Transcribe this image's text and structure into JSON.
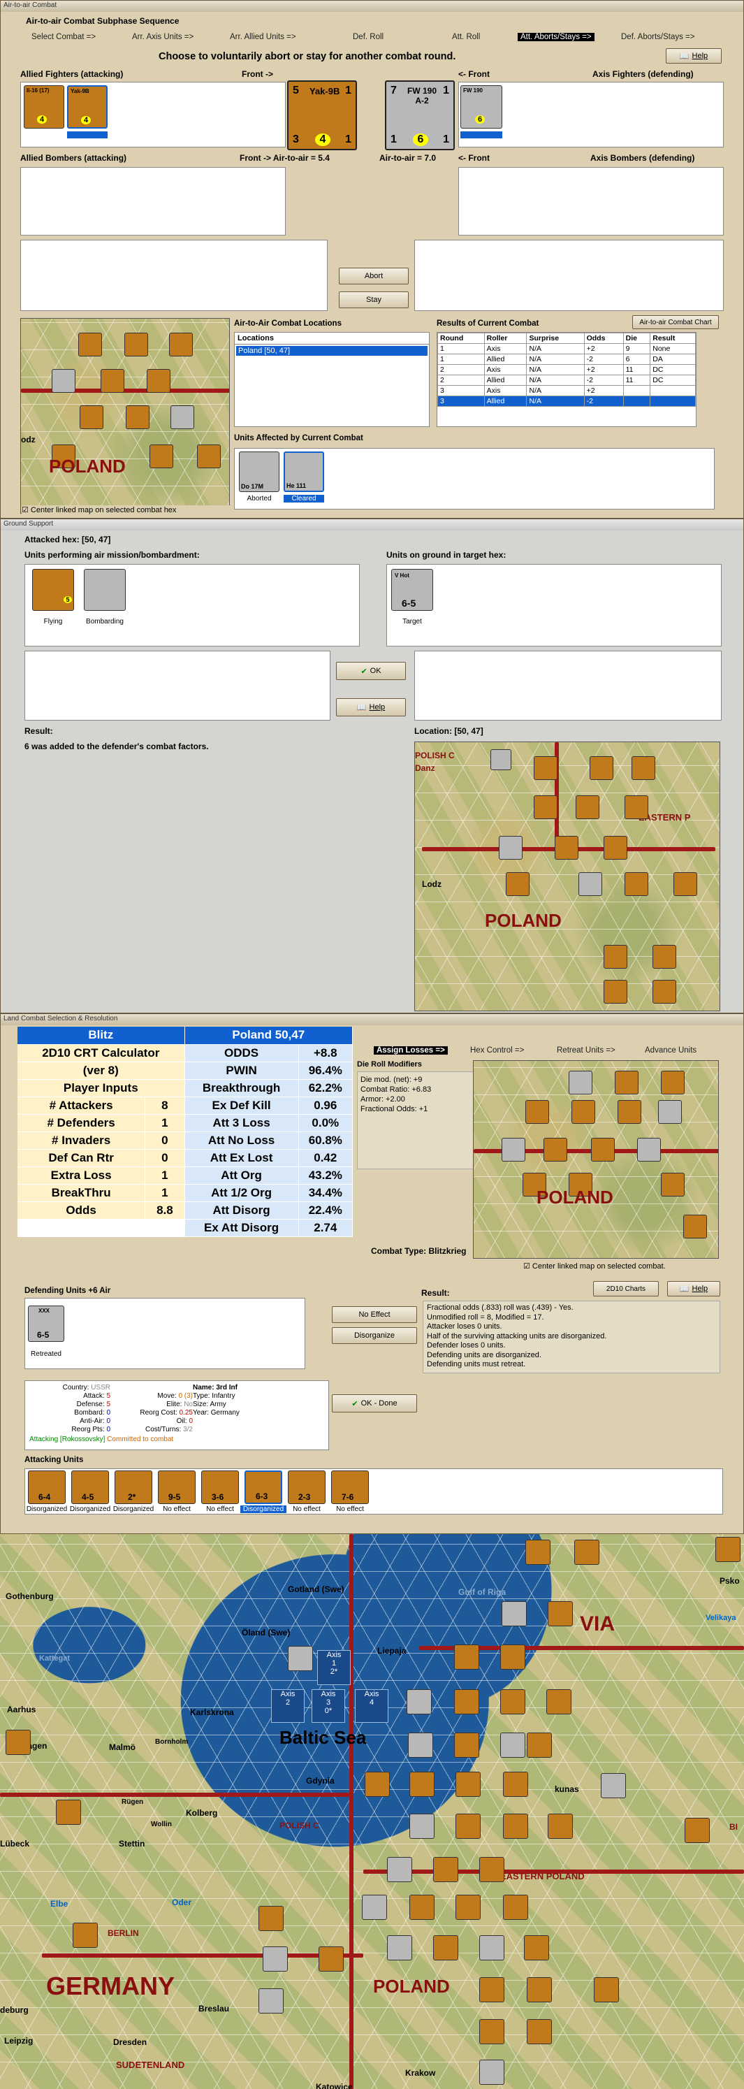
{
  "aircombat": {
    "title": "Air-to-air Combat",
    "heading": "Air-to-air Combat Subphase Sequence",
    "tabs": [
      "Select Combat =>",
      "Arr. Axis Units =>",
      "Arr. Allied Units =>",
      "Def. Roll",
      "Att. Roll",
      "Att. Aborts/Stays =>",
      "Def. Aborts/Stays =>"
    ],
    "active_tab": "Att. Aborts/Stays =>",
    "help_label": "Help",
    "instruction": "Choose to voluntarily abort or stay for another combat round.",
    "allied_fighters_label": "Allied Fighters (attacking)",
    "front_right_label": "Front ->",
    "front_left_label": "<- Front",
    "axis_fighters_label": "Axis Fighters (defending)",
    "allied_bombers_label": "Allied Bombers (attacking)",
    "air_to_air_att": "Front -> Air-to-air = 5.4",
    "air_to_air_def": "Air-to-air = 7.0",
    "axis_bombers_label": "Axis Bombers (defending)",
    "abort_label": "Abort",
    "stay_label": "Stay",
    "locations_section": "Air-to-Air Combat Locations",
    "locations_header": "Locations",
    "locations": [
      "Poland [50, 47]"
    ],
    "results_section": "Results of Current Combat",
    "chart_button": "Air-to-air Combat Chart",
    "results_headers": [
      "Round",
      "Roller",
      "Surprise",
      "Odds",
      "Die",
      "Result"
    ],
    "results_rows": [
      [
        "1",
        "Axis",
        "N/A",
        "+2",
        "9",
        "None"
      ],
      [
        "1",
        "Allied",
        "N/A",
        "-2",
        "6",
        "DA"
      ],
      [
        "2",
        "Axis",
        "N/A",
        "+2",
        "11",
        "DC"
      ],
      [
        "2",
        "Allied",
        "N/A",
        "-2",
        "11",
        "DC"
      ],
      [
        "3",
        "Axis",
        "N/A",
        "+2",
        "",
        ""
      ],
      [
        "3",
        "Allied",
        "N/A",
        "-2",
        "",
        ""
      ]
    ],
    "units_affected_label": "Units Affected by Current Combat",
    "affected": [
      {
        "name": "Do 17M",
        "status": "Aborted"
      },
      {
        "name": "He 111",
        "status": "Cleared"
      }
    ],
    "center_map_label": "Center linked map on selected combat hex",
    "map_poland": "POLAND",
    "map_lodz": "odz",
    "front_unit_left": {
      "top": "Yak-9B",
      "tl": "5",
      "tr": "1",
      "bl": "3",
      "bc": "4",
      "br": "1"
    },
    "front_unit_right": {
      "top": "FW 190 A-2",
      "tl": "7",
      "tr": "1",
      "bl": "1",
      "bc": "6",
      "br": "1"
    },
    "small_units": [
      "Il-16 (17)",
      "Yak-9B",
      "FW 190"
    ]
  },
  "ground": {
    "title": "Ground Support",
    "attacked_hex": "Attacked hex: [50, 47]",
    "performing_label": "Units performing air mission/bombardment:",
    "on_ground_label": "Units on ground in target hex:",
    "flying_caption": "Flying",
    "bombarding_caption": "Bombarding",
    "target_caption": "Target",
    "target_unit": {
      "top": "V Hot",
      "val": "6-5"
    },
    "ok_label": "OK",
    "help_label": "Help",
    "result_label": "Result:",
    "result_text": "6 was added to the defender's combat factors.",
    "location_label": "Location:",
    "location_value": "[50, 47]",
    "map_labels": [
      "POLAND",
      "EASTERN P",
      "Lodz",
      "POLISH C",
      "Danz"
    ]
  },
  "land": {
    "title": "Land Combat Selection & Resolution",
    "crt_header_left": "Blitz",
    "crt_header_right": "Poland 50,47",
    "crt_rows": [
      [
        "2D10 CRT Calculator",
        "",
        "ODDS",
        "+8.8"
      ],
      [
        "(ver 8)",
        "",
        "PWIN",
        "96.4%"
      ],
      [
        "Player Inputs",
        "",
        "Breakthrough",
        "62.2%"
      ],
      [
        "# Attackers",
        "8",
        "Ex Def Kill",
        "0.96"
      ],
      [
        "# Defenders",
        "1",
        "Att 3 Loss",
        "0.0%"
      ],
      [
        "# Invaders",
        "0",
        "Att No Loss",
        "60.8%"
      ],
      [
        "Def Can Rtr",
        "0",
        "Att Ex Lost",
        "0.42"
      ],
      [
        "Extra Loss",
        "1",
        "Att Org",
        "43.2%"
      ],
      [
        "BreakThru",
        "1",
        "Att 1/2 Org",
        "34.4%"
      ],
      [
        "Odds",
        "8.8",
        "Att Disorg",
        "22.4%"
      ],
      [
        "",
        "",
        "Ex Att Disorg",
        "2.74"
      ]
    ],
    "tabs": [
      "Assign Losses =>",
      "Hex Control =>",
      "Retreat Units =>",
      "Advance Units"
    ],
    "active_tab": "Assign Losses =>",
    "dieroll_label": "Die Roll Modifiers",
    "dieroll_lines": [
      "Die mod. (net): +9",
      "",
      "Combat Ratio: +6.83",
      "Armor: +2.00",
      "Fractional Odds: +1"
    ],
    "combat_type": "Combat Type: Blitzkrieg",
    "center_map_label": "Center linked map on selected combat.",
    "defending_label": "Defending Units +6 Air",
    "retreated_caption": "Retreated",
    "def_unit": {
      "top": "XXX",
      "val": "6-5"
    },
    "no_effect_label": "No Effect",
    "disorganize_label": "Disorganize",
    "chart_button": "2D10 Charts",
    "help_label": "Help",
    "result_label": "Result:",
    "result_lines": [
      "Fractional odds (.833) roll was (.439)  - Yes.",
      "Unmodified roll = 8, Modified = 17.",
      "Attacker loses 0 units.",
      "Half of the surviving attacking units are disorganized.",
      "Defender loses 0 units.",
      "Defending units are disorganized.",
      "Defending units must retreat."
    ],
    "info": {
      "country_l": "Country:",
      "country": "USSR",
      "attack_l": "Attack:",
      "attack": "5",
      "defense_l": "Defense:",
      "defense": "5",
      "bombard_l": "Bombard:",
      "bombard": "0",
      "antiair_l": "Anti-Air:",
      "antiair": "0",
      "reorg_l": "Reorg Pts:",
      "reorg": "0",
      "name_l": "Name:",
      "name": "3rd Inf",
      "move_l": "Move:",
      "move": "0 (3)",
      "type_l": "Type:",
      "type": "Infantry",
      "elite_l": "Elite:",
      "elite": "No",
      "size_l": "Size:",
      "size": "Army",
      "rcost_l": "Reorg Cost:",
      "rcost": "0.25",
      "year_l": "Year:",
      "year": "Germany",
      "oil_l": "Oil:",
      "oil": "0",
      "cost_l": "Cost/Turns:",
      "cost": "3/2",
      "attacking": "Attacking [Rokossovsky]",
      "committed": "Committed to combat"
    },
    "ok_done_label": "OK - Done",
    "attacking_label": "Attacking Units",
    "attackers": [
      {
        "val": "6-4",
        "cap": "Disorganized"
      },
      {
        "val": "4-5",
        "cap": "Disorganized"
      },
      {
        "val": "2*",
        "cap": "Disorganized"
      },
      {
        "val": "9-5",
        "cap": "No effect"
      },
      {
        "val": "3-6",
        "cap": "No effect"
      },
      {
        "val": "6-3",
        "cap": "Disorganized"
      },
      {
        "val": "2-3",
        "cap": "No effect"
      },
      {
        "val": "7-6",
        "cap": "No effect"
      }
    ],
    "map_labels": [
      "POLAND"
    ]
  },
  "bigmap": {
    "labels": {
      "gothenburg": "Gothenburg",
      "gotland": "Gotland (Swe)",
      "gulf": "Gulf of Riga",
      "pskov": "Psko",
      "latvia": "VIA",
      "velikaya": "Velikaya",
      "kattegat": "Kattegat",
      "oland": "Öland (Swe)",
      "liepaja": "Liepaja",
      "aarhus": "Aarhus",
      "karlskrona": "Karlskrona",
      "baltic": "Baltic Sea",
      "enhagen": "enhagen",
      "malmo": "Malmö",
      "bornholm": "Bornholm",
      "gdynia": "Gdynia",
      "kunas": "kunas",
      "rugen": "Rügen",
      "wollin": "Wollin",
      "kolberg": "Kolberg",
      "polish": "POLISH C",
      "lubeck": "Lübeck",
      "stettin": "Stettin",
      "eastern": "EASTERN POLAND",
      "elbe": "Elbe",
      "oder": "Oder",
      "berlin": "BERLIN",
      "germany": "GERMANY",
      "poland": "POLAND",
      "breslau": "Breslau",
      "leipzig": "Leipzig",
      "dresden": "Dresden",
      "sudeten": "SUDETENLAND",
      "krakow": "Krakow",
      "katowice": "Katowice",
      "deburg": "deburg",
      "bi": "BI"
    },
    "axis_boxes": [
      {
        "label": "Axis",
        "num": "1",
        "sub": "2*"
      },
      {
        "label": "Axis",
        "num": "2",
        "sub": ""
      },
      {
        "label": "Axis",
        "num": "3",
        "sub": "0*"
      },
      {
        "label": "Axis",
        "num": "4",
        "sub": ""
      }
    ]
  },
  "colors": {
    "accent": "#1060d0",
    "german": "#c07a1c",
    "soviet": "#b8b8b8",
    "border_red": "#a01818"
  }
}
